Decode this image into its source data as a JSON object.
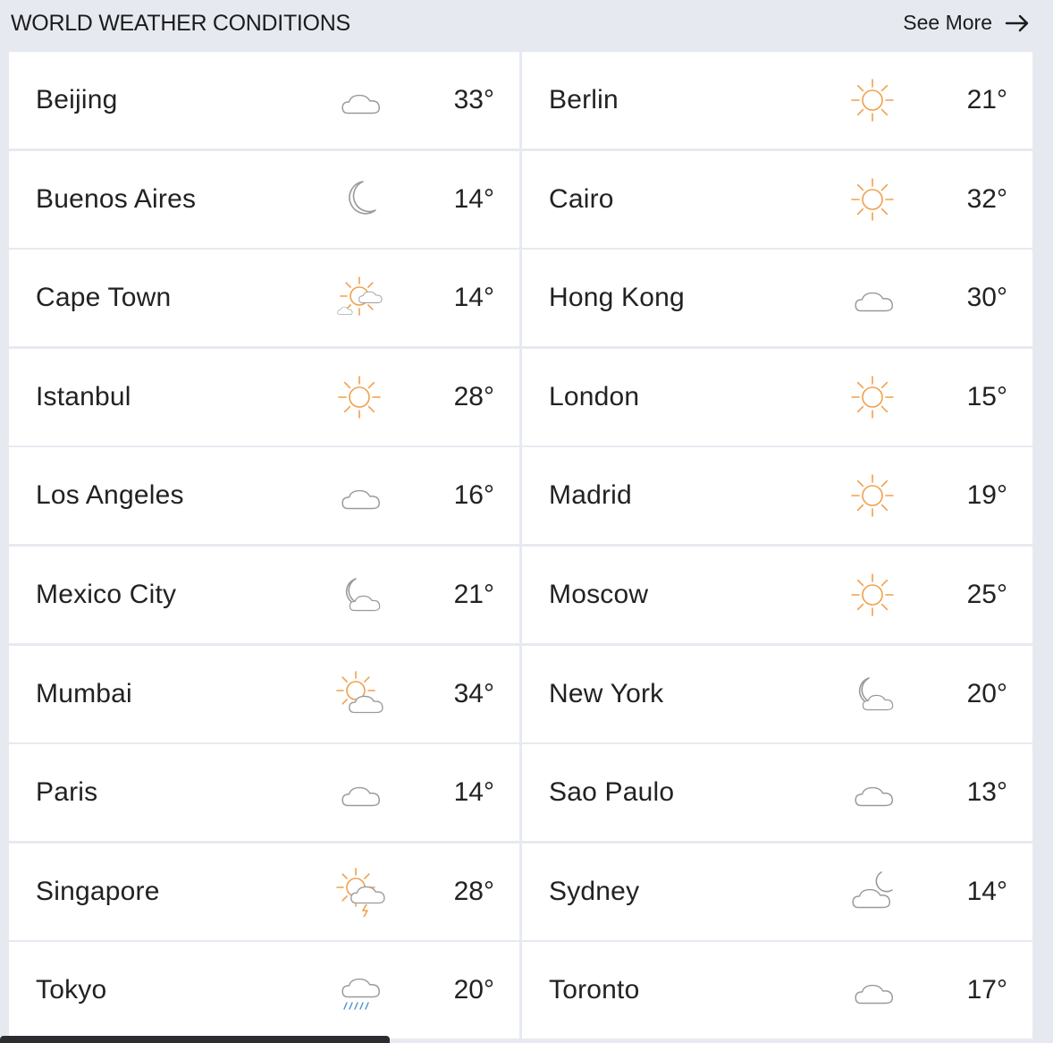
{
  "header": {
    "title": "WORLD WEATHER CONDITIONS",
    "see_more": "See More"
  },
  "cities": [
    {
      "name": "Beijing",
      "temp": "33°",
      "icon": "cloud-icon"
    },
    {
      "name": "Berlin",
      "temp": "21°",
      "icon": "sun-icon"
    },
    {
      "name": "Buenos Aires",
      "temp": "14°",
      "icon": "moon-icon"
    },
    {
      "name": "Cairo",
      "temp": "32°",
      "icon": "sun-icon"
    },
    {
      "name": "Cape Town",
      "temp": "14°",
      "icon": "partly-sunny-icon"
    },
    {
      "name": "Hong Kong",
      "temp": "30°",
      "icon": "cloud-icon"
    },
    {
      "name": "Istanbul",
      "temp": "28°",
      "icon": "sun-icon"
    },
    {
      "name": "London",
      "temp": "15°",
      "icon": "sun-icon"
    },
    {
      "name": "Los Angeles",
      "temp": "16°",
      "icon": "cloud-icon"
    },
    {
      "name": "Madrid",
      "temp": "19°",
      "icon": "sun-icon"
    },
    {
      "name": "Mexico City",
      "temp": "21°",
      "icon": "moon-cloud-icon"
    },
    {
      "name": "Moscow",
      "temp": "25°",
      "icon": "sun-icon"
    },
    {
      "name": "Mumbai",
      "temp": "34°",
      "icon": "sun-cloud-icon"
    },
    {
      "name": "New York",
      "temp": "20°",
      "icon": "moon-cloud-icon"
    },
    {
      "name": "Paris",
      "temp": "14°",
      "icon": "cloud-icon"
    },
    {
      "name": "Sao Paulo",
      "temp": "13°",
      "icon": "cloud-icon"
    },
    {
      "name": "Singapore",
      "temp": "28°",
      "icon": "sun-thunder-icon"
    },
    {
      "name": "Sydney",
      "temp": "14°",
      "icon": "cloud-moon-icon"
    },
    {
      "name": "Tokyo",
      "temp": "20°",
      "icon": "rain-icon"
    },
    {
      "name": "Toronto",
      "temp": "17°",
      "icon": "cloud-icon"
    }
  ],
  "colors": {
    "sun": "#f0a04b",
    "cloud": "#9a9a9a",
    "rain": "#4a90d9"
  }
}
